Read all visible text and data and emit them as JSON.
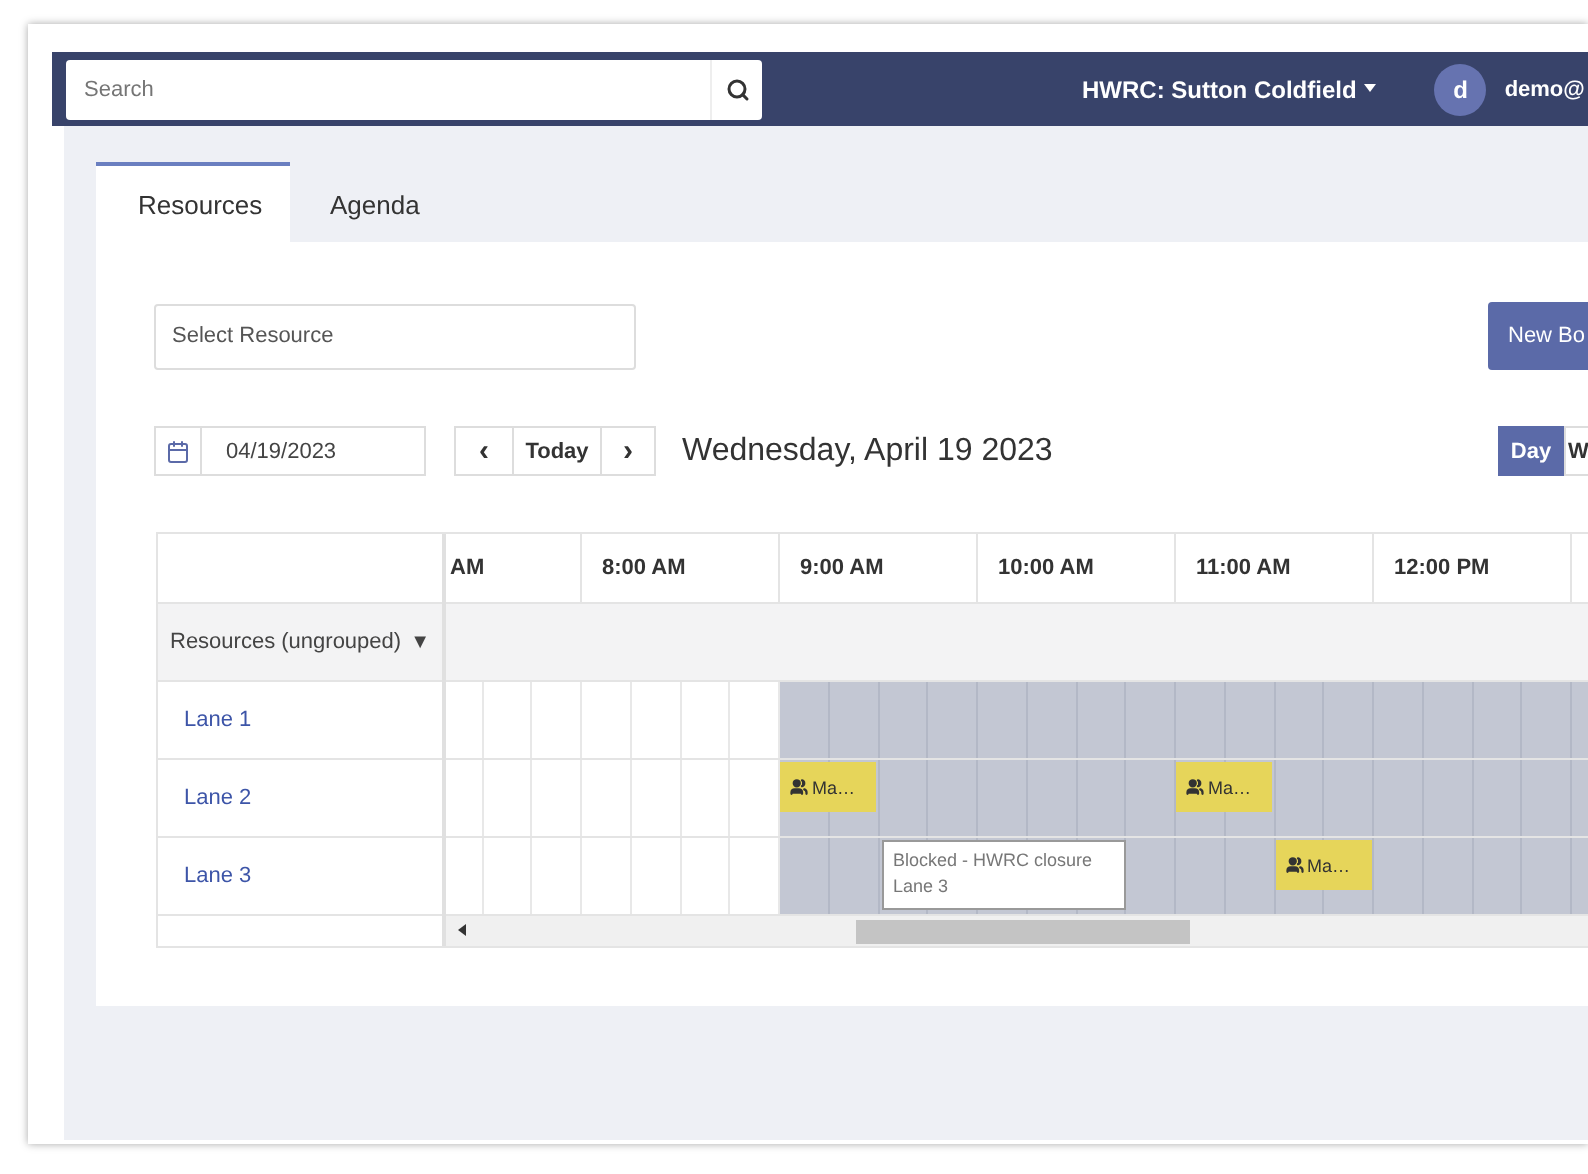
{
  "navbar": {
    "search": {
      "placeholder": "Search"
    },
    "location": "HWRC: Sutton Coldfield",
    "avatar": "d",
    "user": "demo@"
  },
  "tabs": [
    {
      "label": "Resources",
      "selected": true
    },
    {
      "label": "Agenda",
      "selected": false
    }
  ],
  "resource_select": {
    "placeholder": "Select Resource"
  },
  "new_button": "New Bo",
  "date_field": {
    "value": "04/19/2023"
  },
  "nav": {
    "prev": "‹",
    "today": "Today",
    "next": "›"
  },
  "date_title": "Wednesday, April 19 2023",
  "views": [
    {
      "label": "Day",
      "selected": true
    },
    {
      "label": "W",
      "selected": false
    }
  ],
  "timeline": {
    "columns": [
      {
        "label": "AM"
      },
      {
        "label": "8:00 AM"
      },
      {
        "label": "9:00 AM"
      },
      {
        "label": "10:00 AM"
      },
      {
        "label": "11:00 AM"
      },
      {
        "label": "12:00 PM"
      }
    ],
    "group": {
      "label": "Resources (ungrouped)",
      "toggle": "▼"
    },
    "lanes": [
      {
        "name": "Lane 1",
        "cells": [
          {
            "blocked": false
          },
          {
            "blocked": false
          },
          {
            "blocked": false
          },
          {
            "blocked": false
          },
          {
            "blocked": false
          },
          {
            "blocked": false
          },
          {
            "blocked": false
          },
          {
            "blocked": true
          },
          {
            "blocked": true
          },
          {
            "blocked": true
          },
          {
            "blocked": true
          },
          {
            "blocked": true
          },
          {
            "blocked": true
          },
          {
            "blocked": true
          },
          {
            "blocked": true
          },
          {
            "blocked": true
          },
          {
            "blocked": true
          },
          {
            "blocked": true
          },
          {
            "blocked": true
          },
          {
            "blocked": true
          },
          {
            "blocked": true
          },
          {
            "blocked": true
          },
          {
            "blocked": true
          },
          {
            "blocked": true
          }
        ]
      },
      {
        "name": "Lane 2",
        "cells": [
          {
            "blocked": false
          },
          {
            "blocked": false
          },
          {
            "blocked": false
          },
          {
            "blocked": false
          },
          {
            "blocked": false
          },
          {
            "blocked": false
          },
          {
            "blocked": false
          },
          {
            "blocked": true,
            "event": "Ma…"
          },
          {
            "blocked": true
          },
          {
            "blocked": true
          },
          {
            "blocked": true
          },
          {
            "blocked": true
          },
          {
            "blocked": true
          },
          {
            "blocked": true
          },
          {
            "blocked": true
          },
          {
            "blocked": true,
            "event": "Ma…"
          },
          {
            "blocked": true
          },
          {
            "blocked": true
          },
          {
            "blocked": true
          },
          {
            "blocked": true
          },
          {
            "blocked": true
          },
          {
            "blocked": true
          },
          {
            "blocked": true
          },
          {
            "blocked": true
          }
        ]
      },
      {
        "name": "Lane 3",
        "cells": [
          {
            "blocked": false
          },
          {
            "blocked": false
          },
          {
            "blocked": false
          },
          {
            "blocked": false
          },
          {
            "blocked": false
          },
          {
            "blocked": false
          },
          {
            "blocked": false
          },
          {
            "blocked": true
          },
          {
            "blocked": true
          },
          {
            "blocked": true,
            "tooltip": [
              "Blocked - HWRC closure",
              "Lane 3"
            ]
          },
          {
            "blocked": true
          },
          {
            "blocked": true
          },
          {
            "blocked": true
          },
          {
            "blocked": true
          },
          {
            "blocked": true
          },
          {
            "blocked": true
          },
          {
            "blocked": true
          },
          {
            "blocked": true,
            "event": "Ma…"
          },
          {
            "blocked": true
          },
          {
            "blocked": true
          },
          {
            "blocked": true
          },
          {
            "blocked": true
          },
          {
            "blocked": true
          },
          {
            "blocked": true
          }
        ]
      }
    ]
  }
}
